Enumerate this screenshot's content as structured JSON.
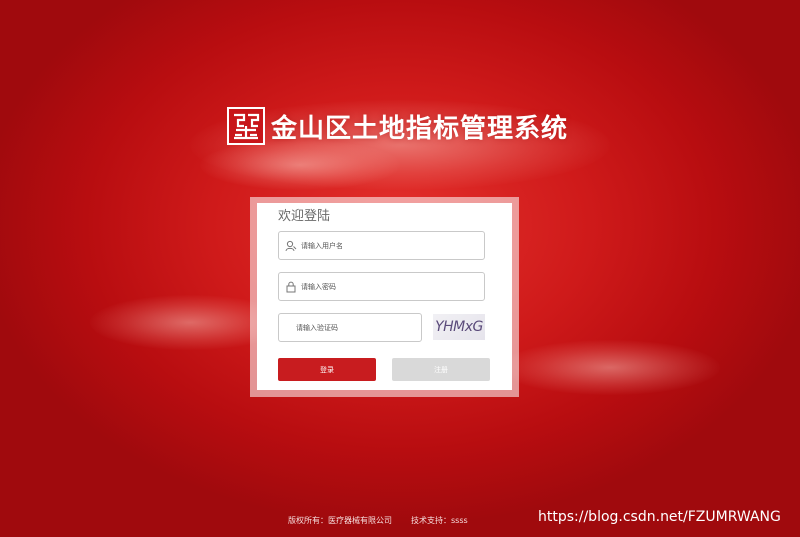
{
  "header": {
    "title": "金山区土地指标管理系统",
    "logo_icon": "seal-logo-icon"
  },
  "login": {
    "welcome": "欢迎登陆",
    "username": {
      "placeholder": "请输入用户名",
      "value": ""
    },
    "password": {
      "placeholder": "请输入密码",
      "value": ""
    },
    "captcha_input": {
      "placeholder": "请输入验证码",
      "value": ""
    },
    "captcha_text": "YHMxG",
    "login_label": "登录",
    "register_label": "注册"
  },
  "footer": {
    "copyright": "版权所有：医疗器械有限公司",
    "support": "技术支持：ssss"
  },
  "watermark": "https://blog.csdn.net/FZUMRWANG",
  "colors": {
    "background": "#c8161a",
    "login_button": "#c81c1f",
    "register_button": "#d9d9d9",
    "text_white": "#ffffff"
  }
}
